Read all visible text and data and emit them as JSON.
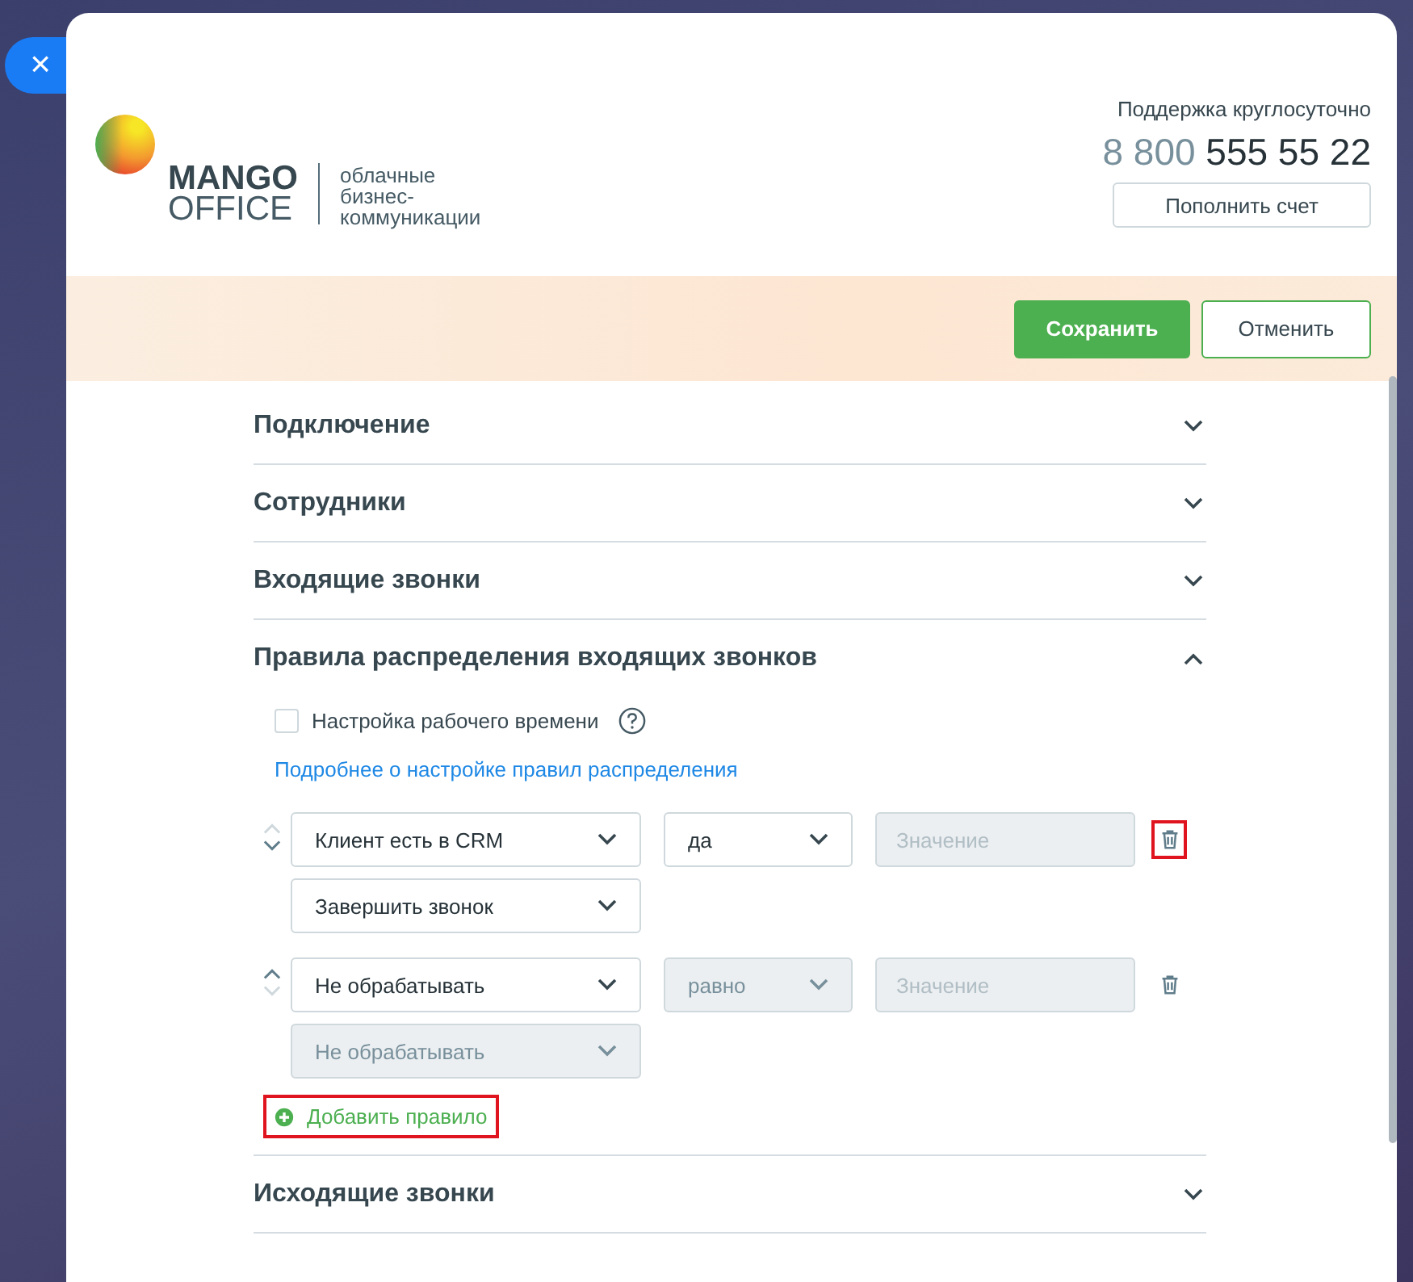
{
  "close_button": {
    "label": "×"
  },
  "logo": {
    "line_1": "MANGO",
    "line_2": "OFFICE",
    "tagline": "облачные бизнес-коммуникации"
  },
  "support": {
    "label": "Поддержка круглосуточно",
    "phone_prefix": "8 800",
    "phone_number": "555 55 22",
    "button": "Пополнить счет"
  },
  "toolbar": {
    "save": "Сохранить",
    "cancel": "Отменить"
  },
  "sections": [
    {
      "title": "Подключение",
      "expanded": false
    },
    {
      "title": "Сотрудники",
      "expanded": false
    },
    {
      "title": "Входящие звонки",
      "expanded": false
    },
    {
      "title": "Правила распределения входящих звонков",
      "expanded": true,
      "body": {
        "checkbox": {
          "label": "Настройка рабочего времени",
          "checked": false
        },
        "link": "Подробнее о настройке правил распределения",
        "rules": [
          {
            "up_enabled": false,
            "down_enabled": true,
            "field": {
              "value": "Клиент есть в CRM",
              "disabled": false
            },
            "operator": {
              "value": "да",
              "disabled": false
            },
            "value": {
              "placeholder": "Значение",
              "disabled": true
            },
            "delete_highlighted": true,
            "action": {
              "value": "Завершить звонок",
              "disabled": false
            }
          },
          {
            "up_enabled": true,
            "down_enabled": false,
            "field": {
              "value": "Не обрабатывать",
              "disabled": false
            },
            "operator": {
              "value": "равно",
              "disabled": true
            },
            "value": {
              "placeholder": "Значение",
              "disabled": true
            },
            "delete_highlighted": false,
            "action": {
              "value": "Не обрабатывать",
              "disabled": true
            }
          }
        ],
        "add_rule": {
          "label": "Добавить правило",
          "highlighted": true
        }
      }
    },
    {
      "title": "Исходящие звонки",
      "expanded": false
    }
  ]
}
